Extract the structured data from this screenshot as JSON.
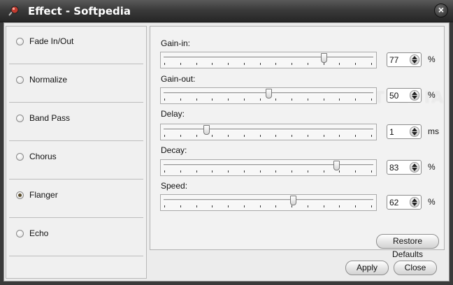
{
  "window": {
    "title": "Effect - Softpedia",
    "app_icon": "app-icon",
    "close_icon": "close-icon"
  },
  "effects": [
    {
      "label": "Fade In/Out",
      "selected": false
    },
    {
      "label": "Normalize",
      "selected": false
    },
    {
      "label": "Band Pass",
      "selected": false
    },
    {
      "label": "Chorus",
      "selected": false
    },
    {
      "label": "Flanger",
      "selected": true
    },
    {
      "label": "Echo",
      "selected": false
    }
  ],
  "params": [
    {
      "label": "Gain-in:",
      "value": "77",
      "unit": "%",
      "fraction": 0.77
    },
    {
      "label": "Gain-out:",
      "value": "50",
      "unit": "%",
      "fraction": 0.5
    },
    {
      "label": "Delay:",
      "value": "1",
      "unit": "ms",
      "fraction": 0.2
    },
    {
      "label": "Decay:",
      "value": "83",
      "unit": "%",
      "fraction": 0.83
    },
    {
      "label": "Speed:",
      "value": "62",
      "unit": "%",
      "fraction": 0.62
    }
  ],
  "watermark": "SOFTPEDIA",
  "buttons": {
    "restore": "Restore Defaults",
    "apply": "Apply",
    "close": "Close"
  }
}
